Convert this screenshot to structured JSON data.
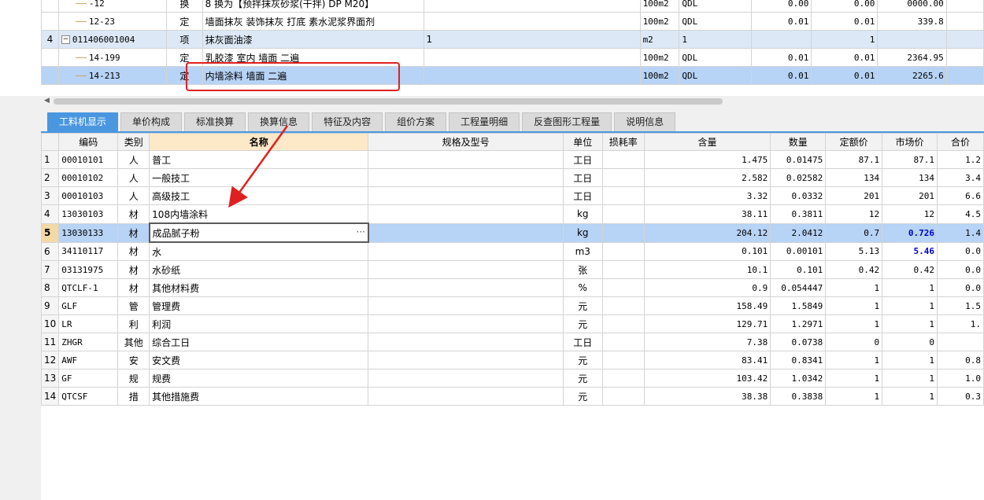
{
  "top": {
    "rows": [
      {
        "num": "",
        "code": "-12",
        "type": "换",
        "name": "8    换为【预拌抹灰砂浆(干拌) DP M20】",
        "spec": "",
        "unit": "100m2",
        "rule": "QDL",
        "a": "0.00",
        "b": "0.00",
        "c": "0000.00",
        "kind": "item"
      },
      {
        "num": "",
        "code": "12-23",
        "type": "定",
        "name": "墙面抹灰 装饰抹灰 打底 素水泥浆界面剂",
        "spec": "",
        "unit": "100m2",
        "rule": "QDL",
        "a": "0.01",
        "b": "0.01",
        "c": "339.8",
        "kind": "item"
      },
      {
        "num": "4",
        "code": "011406001004",
        "type": "项",
        "name": "抹灰面油漆",
        "spec": "1",
        "unit": "m2",
        "rule": "1",
        "a": "",
        "b": "1",
        "c": "",
        "kind": "group"
      },
      {
        "num": "",
        "code": "14-199",
        "type": "定",
        "name": "乳胶漆 室内 墙面 二遍",
        "spec": "",
        "unit": "100m2",
        "rule": "QDL",
        "a": "0.01",
        "b": "0.01",
        "c": "2364.95",
        "kind": "item"
      },
      {
        "num": "",
        "code": "14-213",
        "type": "定",
        "name": "内墙涂料 墙面 二遍",
        "spec": "",
        "unit": "100m2",
        "rule": "QDL",
        "a": "0.01",
        "b": "0.01",
        "c": "2265.6",
        "kind": "sel"
      }
    ]
  },
  "tabs": [
    "工料机显示",
    "单价构成",
    "标准换算",
    "换算信息",
    "特征及内容",
    "组价方案",
    "工程量明细",
    "反查图形工程量",
    "说明信息"
  ],
  "grid": {
    "headers": [
      "",
      "编码",
      "类别",
      "名称",
      "规格及型号",
      "单位",
      "损耗率",
      "含量",
      "数量",
      "定额价",
      "市场价",
      "合价"
    ],
    "rows": [
      [
        "1",
        "00010101",
        "人",
        "普工",
        "",
        "工日",
        "",
        "1.475",
        "0.01475",
        "87.1",
        "87.1",
        "1.2"
      ],
      [
        "2",
        "00010102",
        "人",
        "一般技工",
        "",
        "工日",
        "",
        "2.582",
        "0.02582",
        "134",
        "134",
        "3.4"
      ],
      [
        "3",
        "00010103",
        "人",
        "高级技工",
        "",
        "工日",
        "",
        "3.32",
        "0.0332",
        "201",
        "201",
        "6.6"
      ],
      [
        "4",
        "13030103",
        "材",
        "108内墙涂料",
        "",
        "kg",
        "",
        "38.11",
        "0.3811",
        "12",
        "12",
        "4.5"
      ],
      [
        "5",
        "13030133",
        "材",
        "成品腻子粉",
        "",
        "kg",
        "",
        "204.12",
        "2.0412",
        "0.7",
        "0.726",
        "1.4"
      ],
      [
        "6",
        "34110117",
        "材",
        "水",
        "",
        "m3",
        "",
        "0.101",
        "0.00101",
        "5.13",
        "5.46",
        "0.0"
      ],
      [
        "7",
        "03131975",
        "材",
        "水砂纸",
        "",
        "张",
        "",
        "10.1",
        "0.101",
        "0.42",
        "0.42",
        "0.0"
      ],
      [
        "8",
        "QTCLF-1",
        "材",
        "其他材料费",
        "",
        "%",
        "",
        "0.9",
        "0.054447",
        "1",
        "1",
        "0.0"
      ],
      [
        "9",
        "GLF",
        "管",
        "管理费",
        "",
        "元",
        "",
        "158.49",
        "1.5849",
        "1",
        "1",
        "1.5"
      ],
      [
        "10",
        "LR",
        "利",
        "利润",
        "",
        "元",
        "",
        "129.71",
        "1.2971",
        "1",
        "1",
        "1."
      ],
      [
        "11",
        "ZHGR",
        "其他",
        "综合工日",
        "",
        "工日",
        "",
        "7.38",
        "0.0738",
        "0",
        "0",
        ""
      ],
      [
        "12",
        "AWF",
        "安",
        "安文费",
        "",
        "元",
        "",
        "83.41",
        "0.8341",
        "1",
        "1",
        "0.8"
      ],
      [
        "13",
        "GF",
        "规",
        "规费",
        "",
        "元",
        "",
        "103.42",
        "1.0342",
        "1",
        "1",
        "1.0"
      ],
      [
        "14",
        "QTCSF",
        "措",
        "其他措施费",
        "",
        "元",
        "",
        "38.38",
        "0.3838",
        "1",
        "1",
        "0.3"
      ]
    ],
    "selected_row": 4,
    "highlight_market_rows": [
      4,
      5
    ],
    "ellipsis": "···"
  },
  "colors": {
    "accent": "#4a96e0",
    "annotation": "#e02020",
    "selected": "#b7d3f5"
  }
}
